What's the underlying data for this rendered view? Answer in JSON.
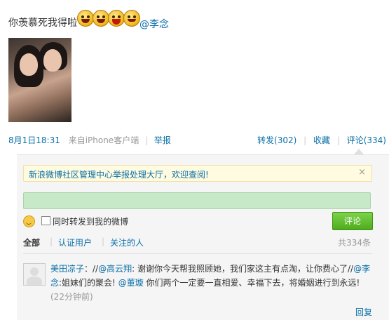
{
  "post": {
    "text": "你羡慕死我得啦",
    "mention": "@李念",
    "emojis": [
      "grin-emoji",
      "laugh-emoji",
      "big-mouth-emoji",
      "smile-emoji"
    ]
  },
  "meta": {
    "date": "8月1日18:31",
    "source": "来自iPhone客户端",
    "report": "举报",
    "forward": "转发(302)",
    "favorite": "收藏",
    "comment": "评论(334)"
  },
  "comments": {
    "notice": "新浪微博社区管理中心举报处理大厅，欢迎查阅!",
    "notice_close": "×",
    "input_value": "",
    "forward_label": "同时转发到我的微博",
    "submit_label": "评论",
    "filters": {
      "all": "全部",
      "verified": "认证用户",
      "following": "关注的人",
      "sep": "|",
      "count": "共334条"
    },
    "items": [
      {
        "author": "美田凉子",
        "colon_prefix": "：//",
        "mention1": "@高云翔",
        "text1": ": 谢谢你今天帮我照顾她，我们家这主有点淘，让你费心了//",
        "mention2": "@李念",
        "text2": ":姐妹们的聚会!",
        "mention3": "@董璇",
        "text3": " 你们两个一定要一直相爱、幸福下去，将婚姻进行到永远!",
        "time": "(22分钟前)",
        "reply": "回复"
      }
    ]
  },
  "colors": {
    "link": "#0a6fa8",
    "input_bg": "#c7e9c7",
    "submit_bg": "#4eac1e",
    "notice_bg": "#fffbe0"
  }
}
